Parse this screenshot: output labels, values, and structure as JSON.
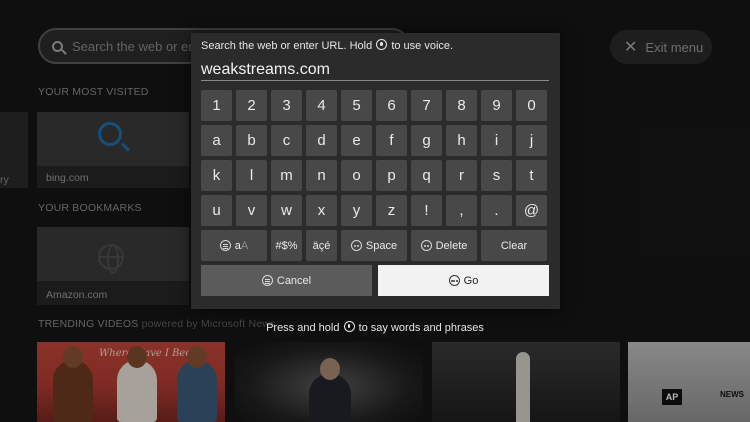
{
  "background": {
    "search_placeholder": "Search the web or en",
    "exit_menu_label": "Exit menu",
    "most_visited_label": "YOUR MOST VISITED",
    "history_label": "ry",
    "most_visited_tile": "bing.com",
    "bookmarks_label": "YOUR BOOKMARKS",
    "bookmark_tile": "Amazon.com",
    "trending_label": "TRENDING VIDEOS",
    "trending_sub": "powered by Microsoft News",
    "video1_title": "Where Have I Been",
    "video4_badge": "AP",
    "video4_news": "NEWS"
  },
  "keyboard": {
    "hint_prefix": "Search the web or enter URL. Hold",
    "hint_suffix": "to use voice.",
    "input_value": "weakstreams.com",
    "rows": [
      [
        "1",
        "2",
        "3",
        "4",
        "5",
        "6",
        "7",
        "8",
        "9",
        "0"
      ],
      [
        "a",
        "b",
        "c",
        "d",
        "e",
        "f",
        "g",
        "h",
        "i",
        "j"
      ],
      [
        "k",
        "l",
        "m",
        "n",
        "o",
        "p",
        "q",
        "r",
        "s",
        "t"
      ],
      [
        "u",
        "v",
        "w",
        "x",
        "y",
        "z",
        "!",
        ",",
        ".",
        "@"
      ]
    ],
    "case_key_a": "a",
    "case_key_b": "A",
    "symbols_key": "#$%",
    "accents_key": "äçé",
    "space_key": "Space",
    "delete_key": "Delete",
    "clear_key": "Clear",
    "cancel_label": "Cancel",
    "go_label": "Go",
    "footer_prefix": "Press and hold",
    "footer_suffix": "to say words and phrases"
  }
}
